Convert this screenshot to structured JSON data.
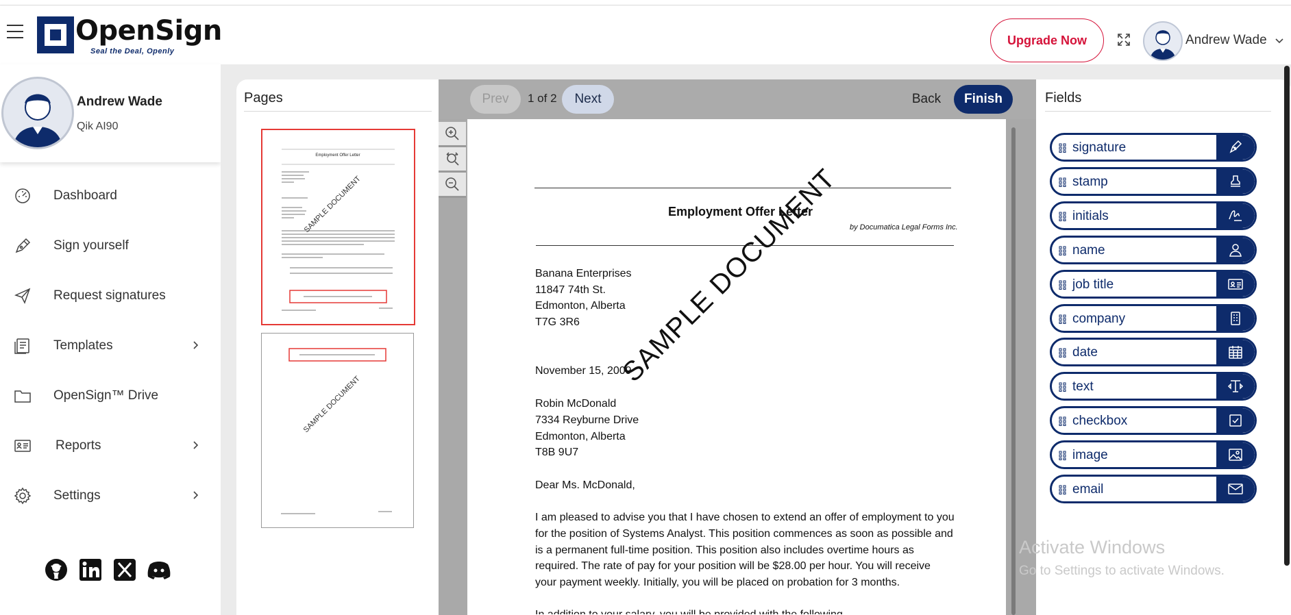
{
  "header": {
    "brand": "OpenSign",
    "tagline": "Seal the Deal, Openly",
    "upgrade_label": "Upgrade Now",
    "user_name": "Andrew Wade"
  },
  "sidebar": {
    "profile_name": "Andrew Wade",
    "profile_org": "Qik AI90",
    "items": [
      {
        "label": "Dashboard",
        "icon": "dashboard-icon",
        "has_chevron": false
      },
      {
        "label": "Sign yourself",
        "icon": "pen-icon",
        "has_chevron": false
      },
      {
        "label": "Request signatures",
        "icon": "send-icon",
        "has_chevron": false
      },
      {
        "label": "Templates",
        "icon": "templates-icon",
        "has_chevron": true
      },
      {
        "label": "OpenSign™ Drive",
        "icon": "folder-icon",
        "has_chevron": false
      },
      {
        "label": "Reports",
        "icon": "reports-icon",
        "has_chevron": true
      },
      {
        "label": "Settings",
        "icon": "gear-icon",
        "has_chevron": true
      }
    ],
    "socials": [
      "github-icon",
      "linkedin-icon",
      "x-icon",
      "discord-icon"
    ]
  },
  "pages_panel": {
    "title": "Pages",
    "thumbnails": [
      {
        "title": "Employment Offer Letter",
        "watermark": "SAMPLE DOCUMENT",
        "active": true
      },
      {
        "title": "",
        "watermark": "SAMPLE DOCUMENT",
        "active": false
      }
    ]
  },
  "toolbar": {
    "prev_label": "Prev",
    "page_count": "1 of 2",
    "next_label": "Next",
    "back_label": "Back",
    "finish_label": "Finish"
  },
  "document": {
    "title": "Employment Offer Letter",
    "byline": "by Documatica Legal Forms Inc.",
    "watermark": "SAMPLE DOCUMENT",
    "sender": [
      "Banana Enterprises",
      "11847 74th St.",
      "Edmonton, Alberta",
      "T7G 3R6"
    ],
    "date": "November 15, 2009",
    "recipient": [
      "Robin McDonald",
      "7334 Reyburne Drive",
      "Edmonton, Alberta",
      "T8B 9U7"
    ],
    "salutation": "Dear Ms. McDonald,",
    "body_lines": [
      "I am pleased to advise you that I have chosen to extend an offer of employment to you",
      "for the position of Systems Analyst.  This position commences as soon as possible and",
      "is a permanent full-time position.  This position also includes overtime hours as",
      "required.  The rate of pay for your position will be $28.00 per hour.  You will receive",
      "your payment weekly.  Initially, you will be placed on probation for 3 months."
    ],
    "cut_line": "In addition to your salary, you will be provided with the following"
  },
  "fields_panel": {
    "title": "Fields",
    "items": [
      {
        "label": "signature",
        "icon": "signature-pen-icon"
      },
      {
        "label": "stamp",
        "icon": "stamp-icon"
      },
      {
        "label": "initials",
        "icon": "initials-icon"
      },
      {
        "label": "name",
        "icon": "user-icon"
      },
      {
        "label": "job title",
        "icon": "id-card-icon"
      },
      {
        "label": "company",
        "icon": "building-icon"
      },
      {
        "label": "date",
        "icon": "calendar-icon"
      },
      {
        "label": "text",
        "icon": "text-cursor-icon"
      },
      {
        "label": "checkbox",
        "icon": "checkbox-icon"
      },
      {
        "label": "image",
        "icon": "image-icon"
      },
      {
        "label": "email",
        "icon": "envelope-icon"
      }
    ]
  },
  "os_watermark": {
    "line1": "Activate Windows",
    "line2": "Go to Settings to activate Windows."
  },
  "colors": {
    "brand_navy": "#0e2b6b",
    "upgrade_red": "#d5133a",
    "thumb_active_border": "#e53935"
  }
}
